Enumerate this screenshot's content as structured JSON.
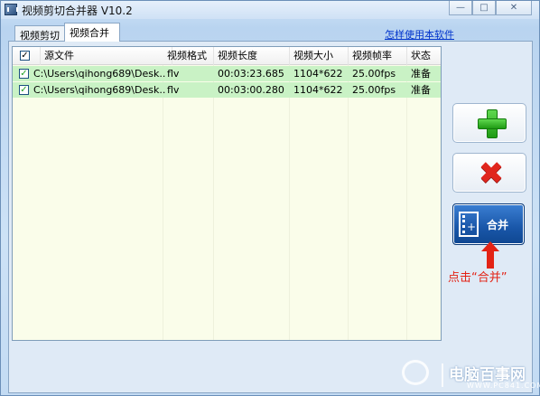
{
  "window": {
    "title": "视频剪切合并器 V10.2",
    "controls": {
      "minimize": "—",
      "maximize": "□",
      "close": "✕"
    }
  },
  "tabs": [
    {
      "label": "视频剪切",
      "active": false
    },
    {
      "label": "视频合并",
      "active": true
    }
  ],
  "help_link": "怎样使用本软件",
  "table": {
    "columns": [
      "源文件",
      "视频格式",
      "视频长度",
      "视频大小",
      "视频帧率",
      "状态"
    ],
    "rows": [
      {
        "checked": true,
        "source": "C:\\Users\\qihong689\\Desk...",
        "format": "flv",
        "duration": "00:03:23.685",
        "size": "1104*622",
        "fps": "25.00fps",
        "status": "准备"
      },
      {
        "checked": true,
        "source": "C:\\Users\\qihong689\\Desk...",
        "format": "flv",
        "duration": "00:03:00.280",
        "size": "1104*622",
        "fps": "25.00fps",
        "status": "准备"
      }
    ]
  },
  "buttons": {
    "add_icon": "plus-icon",
    "delete_icon": "x-icon",
    "merge_label": "合并"
  },
  "annotation": {
    "text": "点击“合并”",
    "color": "#e32315"
  },
  "watermark": {
    "title": "电脑百事网",
    "sub": "WWW.PC841.COM"
  }
}
